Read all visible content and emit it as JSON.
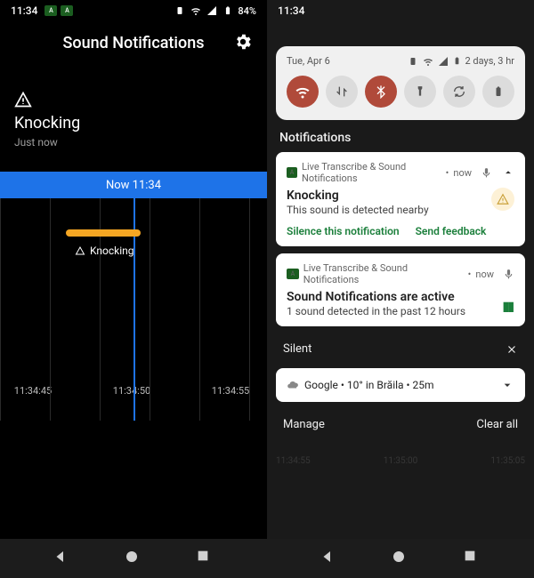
{
  "left": {
    "status": {
      "clock": "11:34",
      "battery": "84%"
    },
    "title": "Sound Notifications",
    "event": {
      "name": "Knocking",
      "time": "Just now"
    },
    "now_label": "Now 11:34",
    "timeline_event_label": "Knocking",
    "axis": [
      "11:34:45",
      "11:34:50",
      "11:34:55"
    ]
  },
  "right": {
    "status": {
      "clock": "11:34"
    },
    "shade": {
      "date": "Tue, Apr 6",
      "battery_text": "2 days, 3 hr",
      "qs": [
        "wifi",
        "data",
        "bluetooth",
        "flashlight",
        "rotate",
        "battery-saver"
      ]
    },
    "section_title": "Notifications",
    "n1": {
      "app": "Live Transcribe & Sound Notifications",
      "when": "now",
      "title": "Knocking",
      "body": "This sound is detected nearby",
      "action1": "Silence this notification",
      "action2": "Send feedback"
    },
    "n2": {
      "app": "Live Transcribe & Sound Notifications",
      "when": "now",
      "title": "Sound Notifications are active",
      "body": "1 sound detected in the past 12 hours"
    },
    "silent_label": "Silent",
    "google": {
      "text": "Google • 10° in Brăila • 25m"
    },
    "manage": "Manage",
    "clear_all": "Clear all",
    "faint_axis": [
      "11:34:55",
      "11:35:00",
      "11:35:05"
    ]
  }
}
